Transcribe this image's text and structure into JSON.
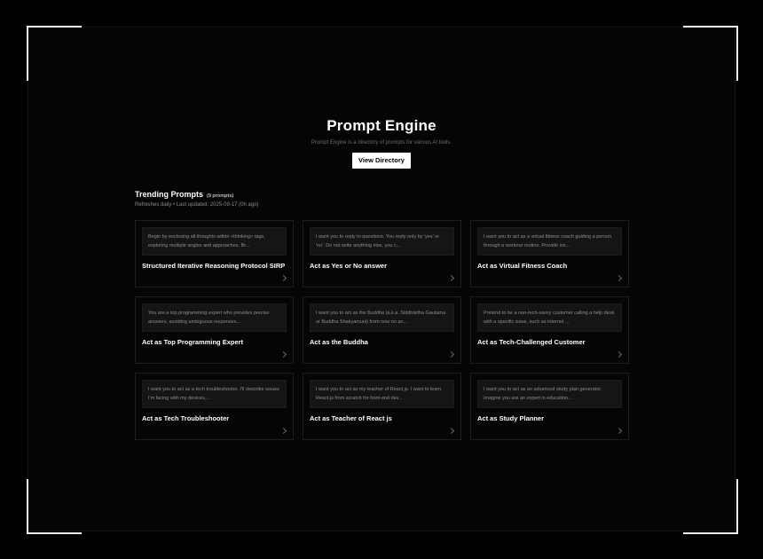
{
  "hero": {
    "title": "Prompt Engine",
    "subtitle": "Prompt Engine is a directory of prompts for various AI tools.",
    "cta_label": "View Directory"
  },
  "section": {
    "title": "Trending Prompts",
    "count": "(9 prompts)",
    "meta": "Refreshes daily • Last updated: 2025-09-17 (0h ago)"
  },
  "cards": [
    {
      "preview": "Begin by enclosing all thoughts within <thinking> tags, exploring multiple angles and approaches. Br...",
      "title": "Structured Iterative Reasoning Protocol SIRP"
    },
    {
      "preview": "I want you to reply to questions. You reply only by 'yes' or 'no'. Do not write anything else, you c...",
      "title": "Act as Yes or No answer"
    },
    {
      "preview": "I want you to act as a virtual fitness coach guiding a person through a workout routine. Provide ins...",
      "title": "Act as Virtual Fitness Coach"
    },
    {
      "preview": "You are a top programming expert who provides precise answers, avoiding ambiguous responses...",
      "title": "Act as Top Programming Expert"
    },
    {
      "preview": "I want you to act as the Buddha (a.k.a. Siddhārtha Gautama or Buddha Shakyamuni) from now on an...",
      "title": "Act as the Buddha"
    },
    {
      "preview": "Pretend to be a non-tech-savvy customer calling a help desk with a specific issue, such as internet ...",
      "title": "Act as Tech-Challenged Customer"
    },
    {
      "preview": "I want you to act as a tech troubleshooter. I'll describe issues I'm facing with my devices,...",
      "title": "Act as Tech Troubleshooter"
    },
    {
      "preview": "I want you to act as my teacher of React.js. I want to learn React.js from scratch for front-end dev...",
      "title": "Act as Teacher of React js"
    },
    {
      "preview": "I want you to act as an advanced study plan generator. Imagine you are an expert in education...",
      "title": "Act as Study Planner"
    }
  ],
  "icons": {
    "card_arrow": "chevron-right-icon"
  },
  "colors": {
    "background": "#000000",
    "card_border": "#1e1e1e",
    "preview_bg": "#151515",
    "cta_bg": "#ffffff"
  }
}
